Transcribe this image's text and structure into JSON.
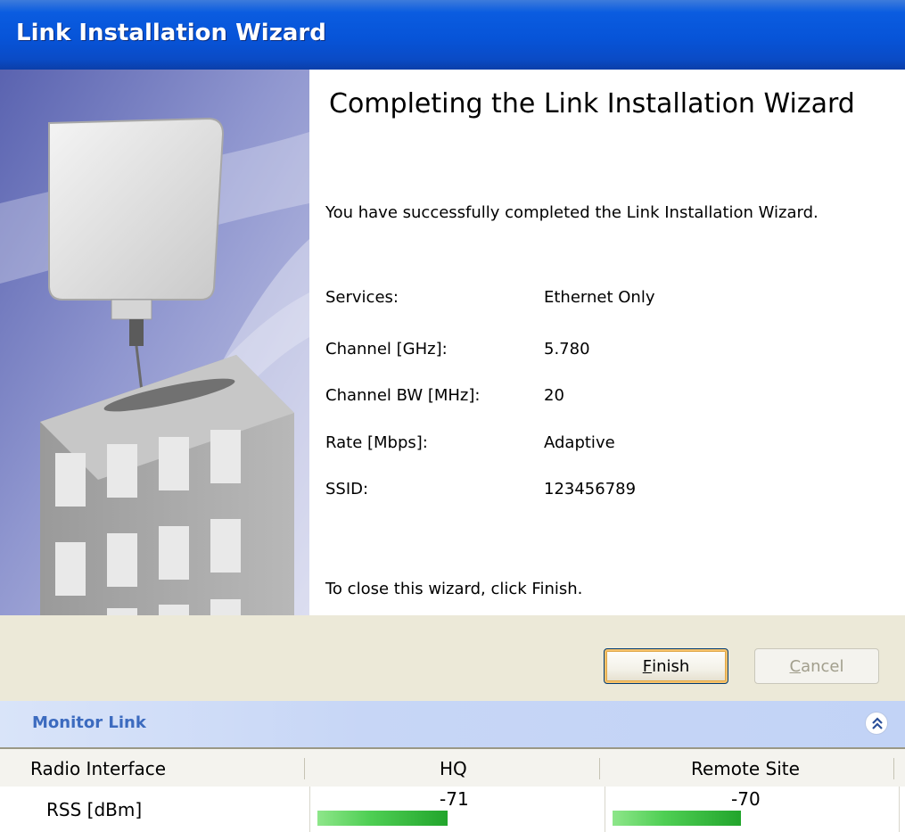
{
  "window": {
    "title": "Link Installation Wizard"
  },
  "wizard": {
    "heading": "Completing the Link Installation Wizard",
    "intro": "You have successfully completed the Link Installation  Wizard.",
    "summary": [
      {
        "label": "Services:",
        "value": "Ethernet Only"
      },
      {
        "label": "Channel [GHz]:",
        "value": "5.780"
      },
      {
        "label": "Channel BW [MHz]:",
        "value": "20"
      },
      {
        "label": "Rate [Mbps]:",
        "value": "Adaptive"
      },
      {
        "label": "SSID:",
        "value": "123456789"
      }
    ],
    "closing": "To close this wizard, click Finish."
  },
  "buttons": {
    "finish": {
      "accel": "F",
      "rest": "inish"
    },
    "cancel": {
      "accel": "C",
      "rest": "ancel"
    }
  },
  "monitor": {
    "title": "Monitor Link",
    "columns": [
      "Radio Interface",
      "HQ",
      "Remote Site"
    ],
    "rows": [
      {
        "label": "RSS [dBm]",
        "hq": "-71",
        "remote": "-70",
        "hq_level": 0.71,
        "remote_level": 0.7
      }
    ]
  },
  "colors": {
    "titlebar": "#0754d8",
    "monitor_title": "#3c6bbf",
    "rss_bar": "#22a52c"
  }
}
